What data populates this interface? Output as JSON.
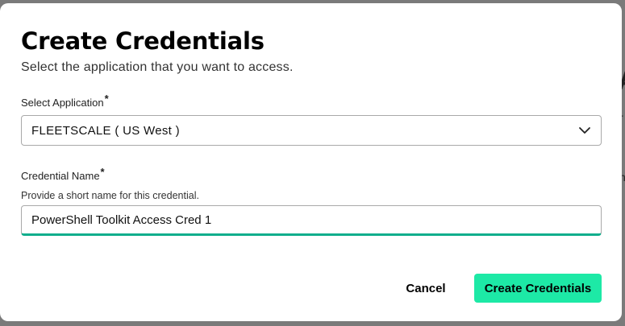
{
  "dialog": {
    "title": "Create Credentials",
    "subtitle": "Select the application that you want to access."
  },
  "application_field": {
    "label": "Select Application",
    "required_mark": "*",
    "selected_value": "FLEETSCALE ( US West )"
  },
  "credential_field": {
    "label": "Credential Name",
    "required_mark": "*",
    "help_text": "Provide a short name for this credential.",
    "value": "PowerShell Toolkit Access Cred 1"
  },
  "actions": {
    "cancel_label": "Cancel",
    "create_label": "Create Credentials"
  },
  "colors": {
    "primary_button": "#1de9a6",
    "focus_underline": "#0fae8c",
    "overlay": "#7a7a7a"
  },
  "icons": {
    "dropdown": "chevron-down-icon"
  }
}
